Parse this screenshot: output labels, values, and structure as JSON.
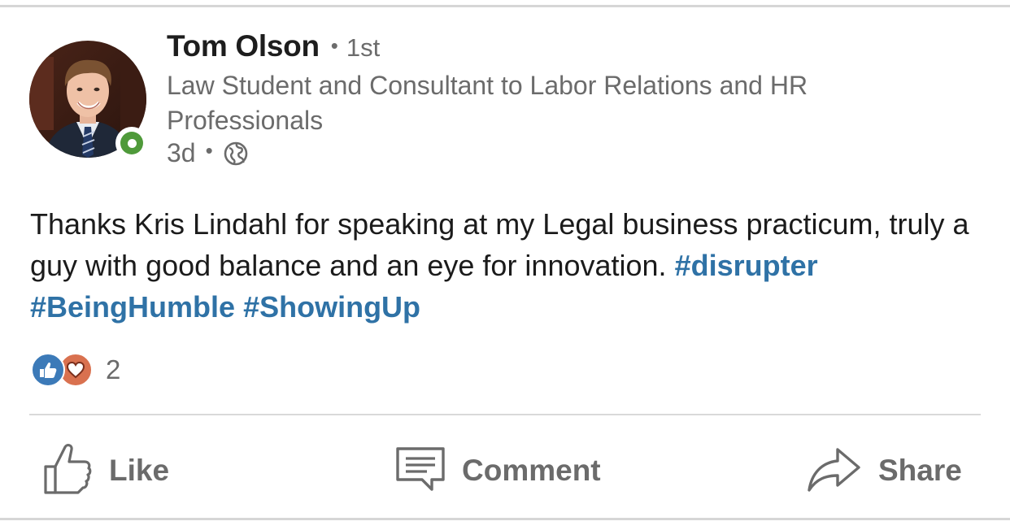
{
  "post": {
    "author": {
      "name": "Tom Olson",
      "separator": "•",
      "connection_degree": "1st",
      "headline": "Law Student and Consultant to Labor Relations and HR Professionals",
      "presence_status": "online",
      "presence_color": "#4f9a3a"
    },
    "meta": {
      "time_ago": "3d",
      "separator": "•",
      "visibility_icon": "globe-icon"
    },
    "body": {
      "text": "Thanks Kris Lindahl for speaking at my Legal business practicum, truly a guy with good balance and an eye for innovation.",
      "hashtags": [
        "#disrupter",
        "#BeingHumble",
        "#ShowingUp"
      ],
      "hashtag_color": "#2f72a6"
    },
    "reactions": {
      "icons": [
        "like-reaction-icon",
        "love-reaction-icon"
      ],
      "count": "2"
    },
    "actions": {
      "like_label": "Like",
      "comment_label": "Comment",
      "share_label": "Share"
    }
  }
}
